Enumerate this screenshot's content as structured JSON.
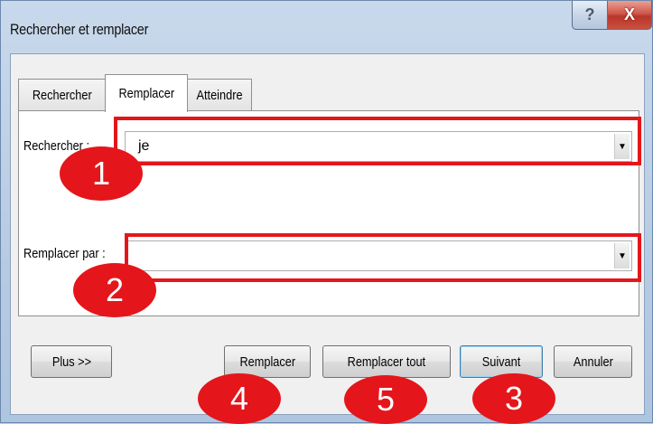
{
  "window": {
    "title": "Rechercher et remplacer",
    "help_label": "?",
    "close_label": "X"
  },
  "tabs": [
    {
      "label": "Rechercher",
      "active": false
    },
    {
      "label": "Remplacer",
      "active": true
    },
    {
      "label": "Atteindre",
      "active": false
    }
  ],
  "find": {
    "label": "Rechercher :",
    "value": "je"
  },
  "replace": {
    "label": "Remplacer par :",
    "value": ""
  },
  "buttons": {
    "more": "Plus >>",
    "replace": "Remplacer",
    "replace_all": "Remplacer tout",
    "next": "Suivant",
    "cancel": "Annuler"
  },
  "markers": [
    "1",
    "2",
    "3",
    "4",
    "5"
  ],
  "colors": {
    "annotation_red": "#e4161b"
  },
  "icons": {
    "dropdown": "▼"
  }
}
